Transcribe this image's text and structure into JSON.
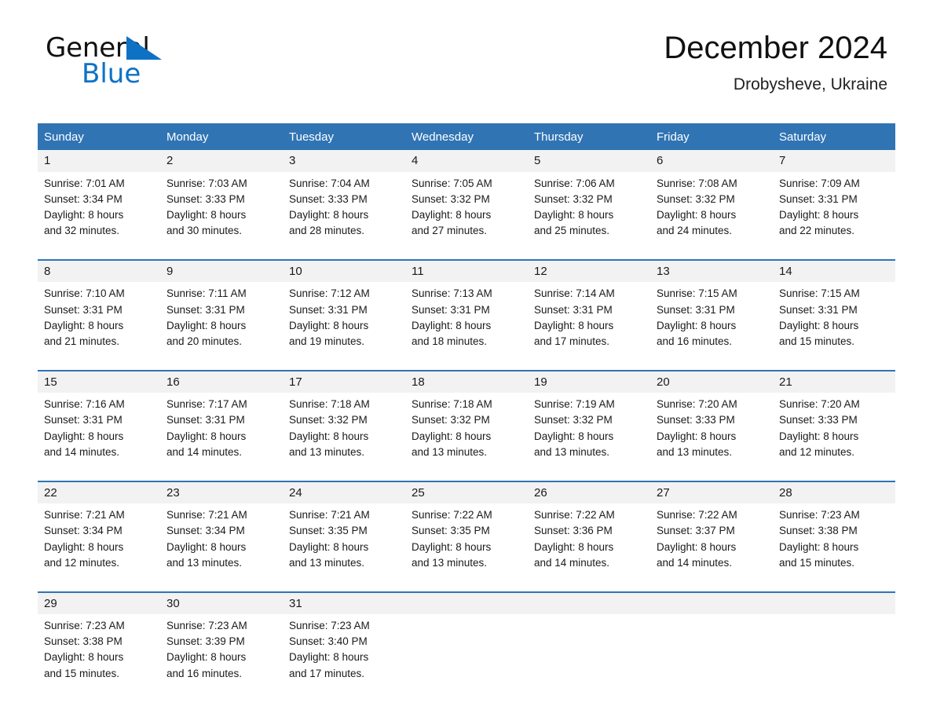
{
  "brand": {
    "name_part1": "General",
    "name_part2": "Blue",
    "triangle_color": "#0E72C4"
  },
  "header": {
    "title": "December 2024",
    "location": "Drobysheve, Ukraine"
  },
  "theme": {
    "header_blue": "#3074B4",
    "row_divider_blue": "#2E74B5",
    "daynum_band": "#F2F2F2",
    "text": "#1a1a1a"
  },
  "weekdays": [
    "Sunday",
    "Monday",
    "Tuesday",
    "Wednesday",
    "Thursday",
    "Friday",
    "Saturday"
  ],
  "weeks": [
    [
      {
        "day": "1",
        "sunrise": "Sunrise: 7:01 AM",
        "sunset": "Sunset: 3:34 PM",
        "daylight_line1": "Daylight: 8 hours",
        "daylight_line2": "and 32 minutes."
      },
      {
        "day": "2",
        "sunrise": "Sunrise: 7:03 AM",
        "sunset": "Sunset: 3:33 PM",
        "daylight_line1": "Daylight: 8 hours",
        "daylight_line2": "and 30 minutes."
      },
      {
        "day": "3",
        "sunrise": "Sunrise: 7:04 AM",
        "sunset": "Sunset: 3:33 PM",
        "daylight_line1": "Daylight: 8 hours",
        "daylight_line2": "and 28 minutes."
      },
      {
        "day": "4",
        "sunrise": "Sunrise: 7:05 AM",
        "sunset": "Sunset: 3:32 PM",
        "daylight_line1": "Daylight: 8 hours",
        "daylight_line2": "and 27 minutes."
      },
      {
        "day": "5",
        "sunrise": "Sunrise: 7:06 AM",
        "sunset": "Sunset: 3:32 PM",
        "daylight_line1": "Daylight: 8 hours",
        "daylight_line2": "and 25 minutes."
      },
      {
        "day": "6",
        "sunrise": "Sunrise: 7:08 AM",
        "sunset": "Sunset: 3:32 PM",
        "daylight_line1": "Daylight: 8 hours",
        "daylight_line2": "and 24 minutes."
      },
      {
        "day": "7",
        "sunrise": "Sunrise: 7:09 AM",
        "sunset": "Sunset: 3:31 PM",
        "daylight_line1": "Daylight: 8 hours",
        "daylight_line2": "and 22 minutes."
      }
    ],
    [
      {
        "day": "8",
        "sunrise": "Sunrise: 7:10 AM",
        "sunset": "Sunset: 3:31 PM",
        "daylight_line1": "Daylight: 8 hours",
        "daylight_line2": "and 21 minutes."
      },
      {
        "day": "9",
        "sunrise": "Sunrise: 7:11 AM",
        "sunset": "Sunset: 3:31 PM",
        "daylight_line1": "Daylight: 8 hours",
        "daylight_line2": "and 20 minutes."
      },
      {
        "day": "10",
        "sunrise": "Sunrise: 7:12 AM",
        "sunset": "Sunset: 3:31 PM",
        "daylight_line1": "Daylight: 8 hours",
        "daylight_line2": "and 19 minutes."
      },
      {
        "day": "11",
        "sunrise": "Sunrise: 7:13 AM",
        "sunset": "Sunset: 3:31 PM",
        "daylight_line1": "Daylight: 8 hours",
        "daylight_line2": "and 18 minutes."
      },
      {
        "day": "12",
        "sunrise": "Sunrise: 7:14 AM",
        "sunset": "Sunset: 3:31 PM",
        "daylight_line1": "Daylight: 8 hours",
        "daylight_line2": "and 17 minutes."
      },
      {
        "day": "13",
        "sunrise": "Sunrise: 7:15 AM",
        "sunset": "Sunset: 3:31 PM",
        "daylight_line1": "Daylight: 8 hours",
        "daylight_line2": "and 16 minutes."
      },
      {
        "day": "14",
        "sunrise": "Sunrise: 7:15 AM",
        "sunset": "Sunset: 3:31 PM",
        "daylight_line1": "Daylight: 8 hours",
        "daylight_line2": "and 15 minutes."
      }
    ],
    [
      {
        "day": "15",
        "sunrise": "Sunrise: 7:16 AM",
        "sunset": "Sunset: 3:31 PM",
        "daylight_line1": "Daylight: 8 hours",
        "daylight_line2": "and 14 minutes."
      },
      {
        "day": "16",
        "sunrise": "Sunrise: 7:17 AM",
        "sunset": "Sunset: 3:31 PM",
        "daylight_line1": "Daylight: 8 hours",
        "daylight_line2": "and 14 minutes."
      },
      {
        "day": "17",
        "sunrise": "Sunrise: 7:18 AM",
        "sunset": "Sunset: 3:32 PM",
        "daylight_line1": "Daylight: 8 hours",
        "daylight_line2": "and 13 minutes."
      },
      {
        "day": "18",
        "sunrise": "Sunrise: 7:18 AM",
        "sunset": "Sunset: 3:32 PM",
        "daylight_line1": "Daylight: 8 hours",
        "daylight_line2": "and 13 minutes."
      },
      {
        "day": "19",
        "sunrise": "Sunrise: 7:19 AM",
        "sunset": "Sunset: 3:32 PM",
        "daylight_line1": "Daylight: 8 hours",
        "daylight_line2": "and 13 minutes."
      },
      {
        "day": "20",
        "sunrise": "Sunrise: 7:20 AM",
        "sunset": "Sunset: 3:33 PM",
        "daylight_line1": "Daylight: 8 hours",
        "daylight_line2": "and 13 minutes."
      },
      {
        "day": "21",
        "sunrise": "Sunrise: 7:20 AM",
        "sunset": "Sunset: 3:33 PM",
        "daylight_line1": "Daylight: 8 hours",
        "daylight_line2": "and 12 minutes."
      }
    ],
    [
      {
        "day": "22",
        "sunrise": "Sunrise: 7:21 AM",
        "sunset": "Sunset: 3:34 PM",
        "daylight_line1": "Daylight: 8 hours",
        "daylight_line2": "and 12 minutes."
      },
      {
        "day": "23",
        "sunrise": "Sunrise: 7:21 AM",
        "sunset": "Sunset: 3:34 PM",
        "daylight_line1": "Daylight: 8 hours",
        "daylight_line2": "and 13 minutes."
      },
      {
        "day": "24",
        "sunrise": "Sunrise: 7:21 AM",
        "sunset": "Sunset: 3:35 PM",
        "daylight_line1": "Daylight: 8 hours",
        "daylight_line2": "and 13 minutes."
      },
      {
        "day": "25",
        "sunrise": "Sunrise: 7:22 AM",
        "sunset": "Sunset: 3:35 PM",
        "daylight_line1": "Daylight: 8 hours",
        "daylight_line2": "and 13 minutes."
      },
      {
        "day": "26",
        "sunrise": "Sunrise: 7:22 AM",
        "sunset": "Sunset: 3:36 PM",
        "daylight_line1": "Daylight: 8 hours",
        "daylight_line2": "and 14 minutes."
      },
      {
        "day": "27",
        "sunrise": "Sunrise: 7:22 AM",
        "sunset": "Sunset: 3:37 PM",
        "daylight_line1": "Daylight: 8 hours",
        "daylight_line2": "and 14 minutes."
      },
      {
        "day": "28",
        "sunrise": "Sunrise: 7:23 AM",
        "sunset": "Sunset: 3:38 PM",
        "daylight_line1": "Daylight: 8 hours",
        "daylight_line2": "and 15 minutes."
      }
    ],
    [
      {
        "day": "29",
        "sunrise": "Sunrise: 7:23 AM",
        "sunset": "Sunset: 3:38 PM",
        "daylight_line1": "Daylight: 8 hours",
        "daylight_line2": "and 15 minutes."
      },
      {
        "day": "30",
        "sunrise": "Sunrise: 7:23 AM",
        "sunset": "Sunset: 3:39 PM",
        "daylight_line1": "Daylight: 8 hours",
        "daylight_line2": "and 16 minutes."
      },
      {
        "day": "31",
        "sunrise": "Sunrise: 7:23 AM",
        "sunset": "Sunset: 3:40 PM",
        "daylight_line1": "Daylight: 8 hours",
        "daylight_line2": "and 17 minutes."
      },
      {
        "day": "",
        "sunrise": "",
        "sunset": "",
        "daylight_line1": "",
        "daylight_line2": ""
      },
      {
        "day": "",
        "sunrise": "",
        "sunset": "",
        "daylight_line1": "",
        "daylight_line2": ""
      },
      {
        "day": "",
        "sunrise": "",
        "sunset": "",
        "daylight_line1": "",
        "daylight_line2": ""
      },
      {
        "day": "",
        "sunrise": "",
        "sunset": "",
        "daylight_line1": "",
        "daylight_line2": ""
      }
    ]
  ]
}
